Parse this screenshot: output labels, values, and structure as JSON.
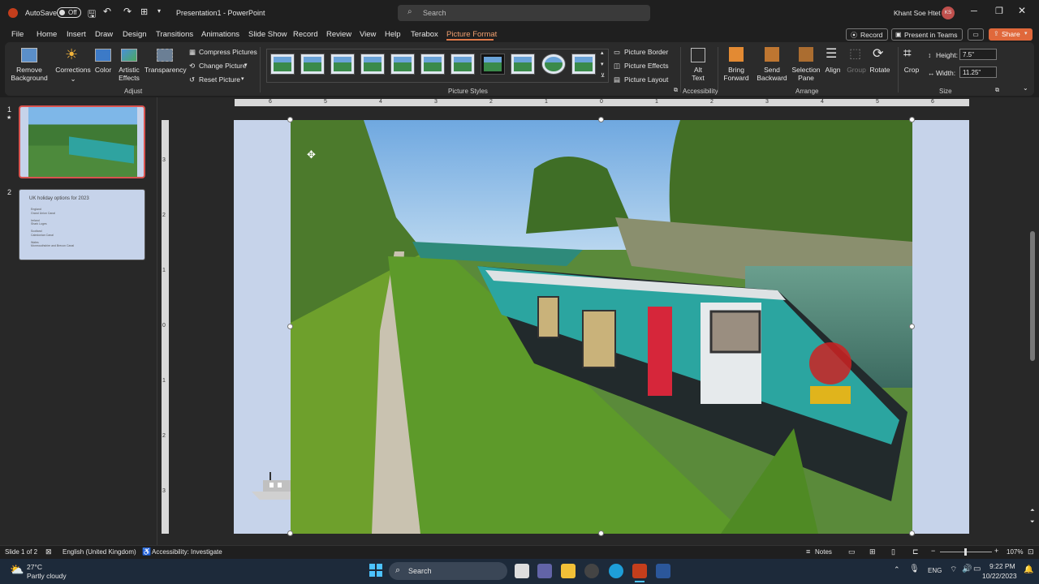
{
  "titlebar": {
    "autosave": "AutoSave",
    "toggle": "Off",
    "doc_title": "Presentation1  -  PowerPoint",
    "search_placeholder": "Search",
    "user": "Khant Soe Htet",
    "user_initials": "KS"
  },
  "tabs": [
    "File",
    "Home",
    "Insert",
    "Draw",
    "Design",
    "Transitions",
    "Animations",
    "Slide Show",
    "Record",
    "Review",
    "View",
    "Help",
    "Terabox",
    "Picture Format"
  ],
  "active_tab": "Picture Format",
  "top_right": {
    "record": "Record",
    "teams": "Present in Teams",
    "share": "Share"
  },
  "ribbon": {
    "adjust": {
      "remove_bg_1": "Remove",
      "remove_bg_2": "Background",
      "corrections": "Corrections",
      "color": "Color",
      "artistic_1": "Artistic",
      "artistic_2": "Effects",
      "transparency": "Transparency",
      "compress": "Compress Pictures",
      "change": "Change Picture",
      "reset": "Reset Picture",
      "label": "Adjust"
    },
    "styles": {
      "label": "Picture Styles",
      "border": "Picture Border",
      "effects": "Picture Effects",
      "layout": "Picture Layout"
    },
    "accessibility": {
      "alt_1": "Alt",
      "alt_2": "Text",
      "label": "Accessibility"
    },
    "arrange": {
      "bring_1": "Bring",
      "bring_2": "Forward",
      "send_1": "Send",
      "send_2": "Backward",
      "sel_1": "Selection",
      "sel_2": "Pane",
      "align": "Align",
      "group": "Group",
      "rotate": "Rotate",
      "label": "Arrange"
    },
    "size": {
      "crop": "Crop",
      "height_label": "Height:",
      "height": "7.5\"",
      "width_label": "Width:",
      "width": "11.25\"",
      "label": "Size"
    }
  },
  "ruler_h": [
    "6",
    "5",
    "4",
    "3",
    "2",
    "1",
    "0",
    "1",
    "2",
    "3",
    "4",
    "5",
    "6"
  ],
  "ruler_v": [
    "3",
    "2",
    "1",
    "0",
    "1",
    "2",
    "3"
  ],
  "slides": [
    {
      "num": "1",
      "star": "★"
    },
    {
      "num": "2",
      "title": "UK holiday options for 2023",
      "bullets": [
        "England",
        "Grand Union Canal",
        "Ireland",
        "Shark Loges",
        "Scotland",
        "Caledonian Canal",
        "Wales",
        "Monmouthshire and Brecon Canal"
      ]
    }
  ],
  "status": {
    "slide": "Slide 1 of 2",
    "lang": "English (United Kingdom)",
    "access": "Accessibility: Investigate",
    "notes": "Notes",
    "zoom": "107%"
  },
  "taskbar": {
    "temp": "27°C",
    "weather": "Partly cloudy",
    "search": "Search",
    "lang": "ENG",
    "time": "9:22 PM",
    "date": "10/22/2023"
  }
}
